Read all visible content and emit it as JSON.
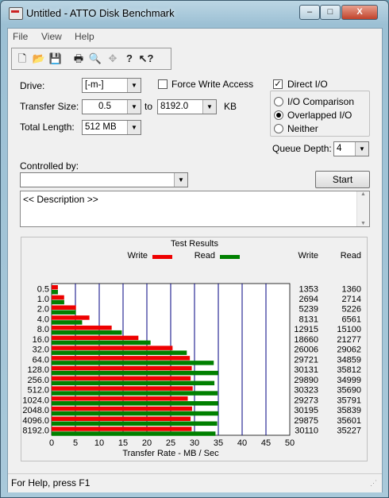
{
  "window": {
    "title": "Untitled - ATTO Disk Benchmark"
  },
  "title_buttons": {
    "minimize": "–",
    "maximize": "□",
    "close": "X"
  },
  "menu": [
    "File",
    "View",
    "Help"
  ],
  "toolbar_icons": [
    "new-icon",
    "open-icon",
    "save-icon",
    "print-icon",
    "print-preview-icon",
    "move-icon",
    "help-icon",
    "context-help-icon"
  ],
  "form": {
    "drive_label": "Drive:",
    "drive_value": "[-m-]",
    "force_write_label": "Force Write Access",
    "force_write_checked": false,
    "direct_io_label": "Direct I/O",
    "direct_io_checked": true,
    "transfer_size_label": "Transfer Size:",
    "transfer_from": "0.5",
    "to_label": "to",
    "transfer_to": "8192.0",
    "kb_label": "KB",
    "total_length_label": "Total Length:",
    "total_length_value": "512 MB",
    "radio_io_comparison": "I/O Comparison",
    "radio_overlapped_io": "Overlapped I/O",
    "radio_neither": "Neither",
    "selected_radio": "Overlapped I/O",
    "queue_depth_label": "Queue Depth:",
    "queue_depth_value": "4",
    "controlled_by_label": "Controlled by:",
    "controlled_by_value": "",
    "start_label": "Start",
    "description_text": "<< Description >>"
  },
  "status_text": "For Help, press F1",
  "colors": {
    "write": "#ee0000",
    "read": "#008000",
    "grid": "#000080"
  },
  "chart_data": {
    "type": "bar",
    "orientation": "horizontal",
    "title": "Test Results",
    "xlabel": "Transfer Rate - MB / Sec",
    "xlim": [
      0,
      50
    ],
    "xticks": [
      0,
      5,
      10,
      15,
      20,
      25,
      30,
      35,
      40,
      45,
      50
    ],
    "categories": [
      "0.5",
      "1.0",
      "2.0",
      "4.0",
      "8.0",
      "16.0",
      "32.0",
      "64.0",
      "128.0",
      "256.0",
      "512.0",
      "1024.0",
      "2048.0",
      "4096.0",
      "8192.0"
    ],
    "legend": [
      "Write",
      "Read"
    ],
    "column_headers": [
      "Write",
      "Read"
    ],
    "series": [
      {
        "name": "Write",
        "values": [
          1353,
          2694,
          5239,
          8131,
          12915,
          18660,
          26006,
          29721,
          30131,
          29890,
          30323,
          29273,
          30195,
          29875,
          30110
        ]
      },
      {
        "name": "Read",
        "values": [
          1360,
          2714,
          5226,
          6561,
          15100,
          21277,
          29062,
          34859,
          35812,
          34999,
          35690,
          35791,
          35839,
          35601,
          35227
        ]
      }
    ]
  }
}
